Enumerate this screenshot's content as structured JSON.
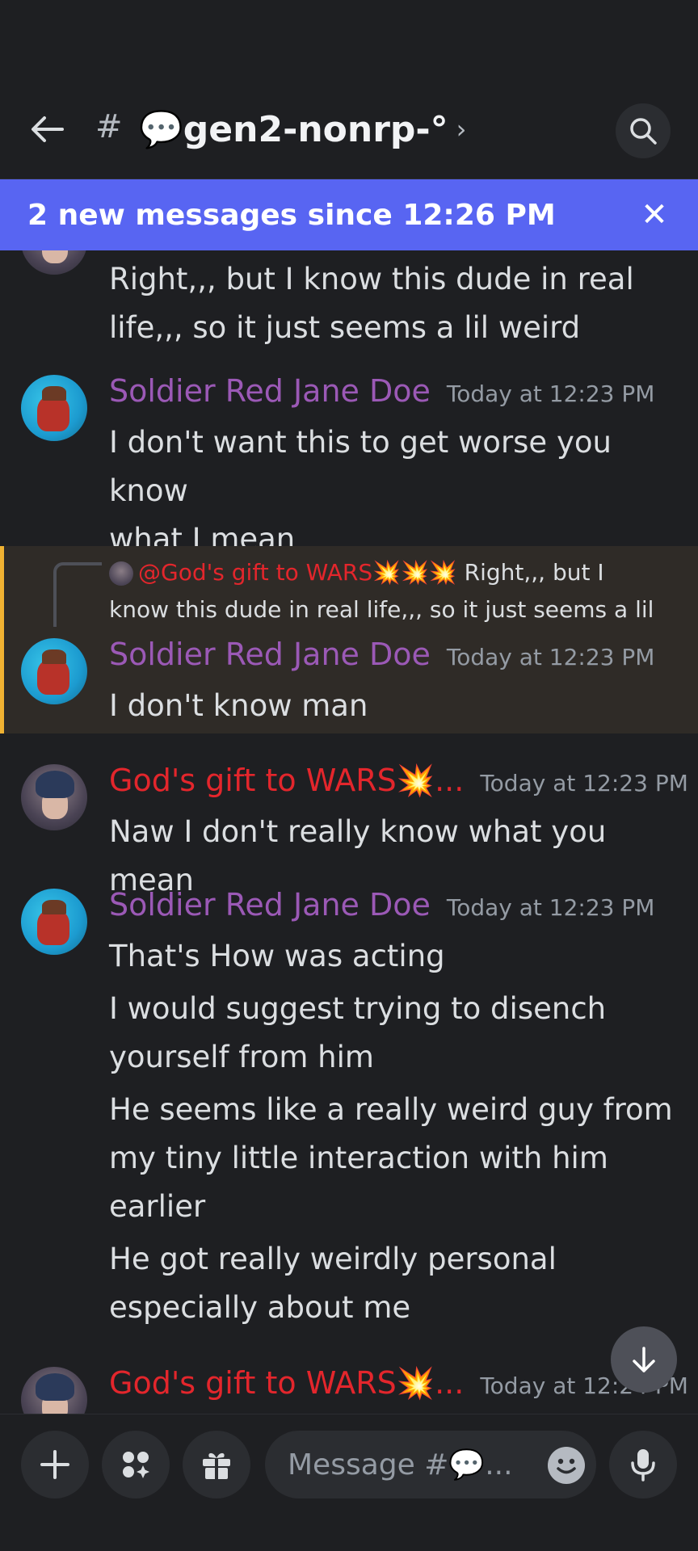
{
  "header": {
    "hash": "#",
    "channel_name": "💬gen2-nonrp-°",
    "chevron": "›"
  },
  "banner": {
    "text": "2 new messages since 12:26 PM",
    "close": "✕"
  },
  "messages": [
    {
      "lines": [
        "Right,,, but I know this dude in real",
        "life,,, so it just seems a lil weird"
      ]
    },
    {
      "author": "Soldier Red Jane Doe",
      "timestamp": "Today at 12:23 PM",
      "lines": [
        "I don't want this to get worse you know",
        "what I mean"
      ]
    },
    {
      "reply": {
        "mention": "@God's gift to WARS💥💥💥",
        "text_line1": " Right,,, but I",
        "text_line2": "know this dude in real life,,, so it just seems a lil"
      },
      "author": "Soldier Red Jane Doe",
      "timestamp": "Today at 12:23 PM",
      "lines": [
        "I don't know man"
      ]
    },
    {
      "author": "God's gift to WARS💥...",
      "timestamp": "Today at 12:23 PM",
      "lines": [
        "Naw I don't really know what you mean"
      ]
    },
    {
      "author": "Soldier Red Jane Doe",
      "timestamp": "Today at 12:23 PM",
      "lines": [
        "That's How was acting",
        "I would suggest trying to disench",
        "yourself from him",
        "He seems like a really weird guy from",
        "my tiny little interaction with him",
        "earlier",
        "He got really weirdly personal",
        "especially about me"
      ]
    },
    {
      "author": "God's gift to WARS💥...",
      "timestamp": "Today at 12:24 PM"
    }
  ],
  "composer": {
    "placeholder": "Message #💬..."
  },
  "colors": {
    "background": "#1e1f22",
    "banner": "#5865f2",
    "soldier_name": "#9b59b6",
    "gods_name": "#e3262c",
    "highlight_bar": "#f0b232"
  }
}
